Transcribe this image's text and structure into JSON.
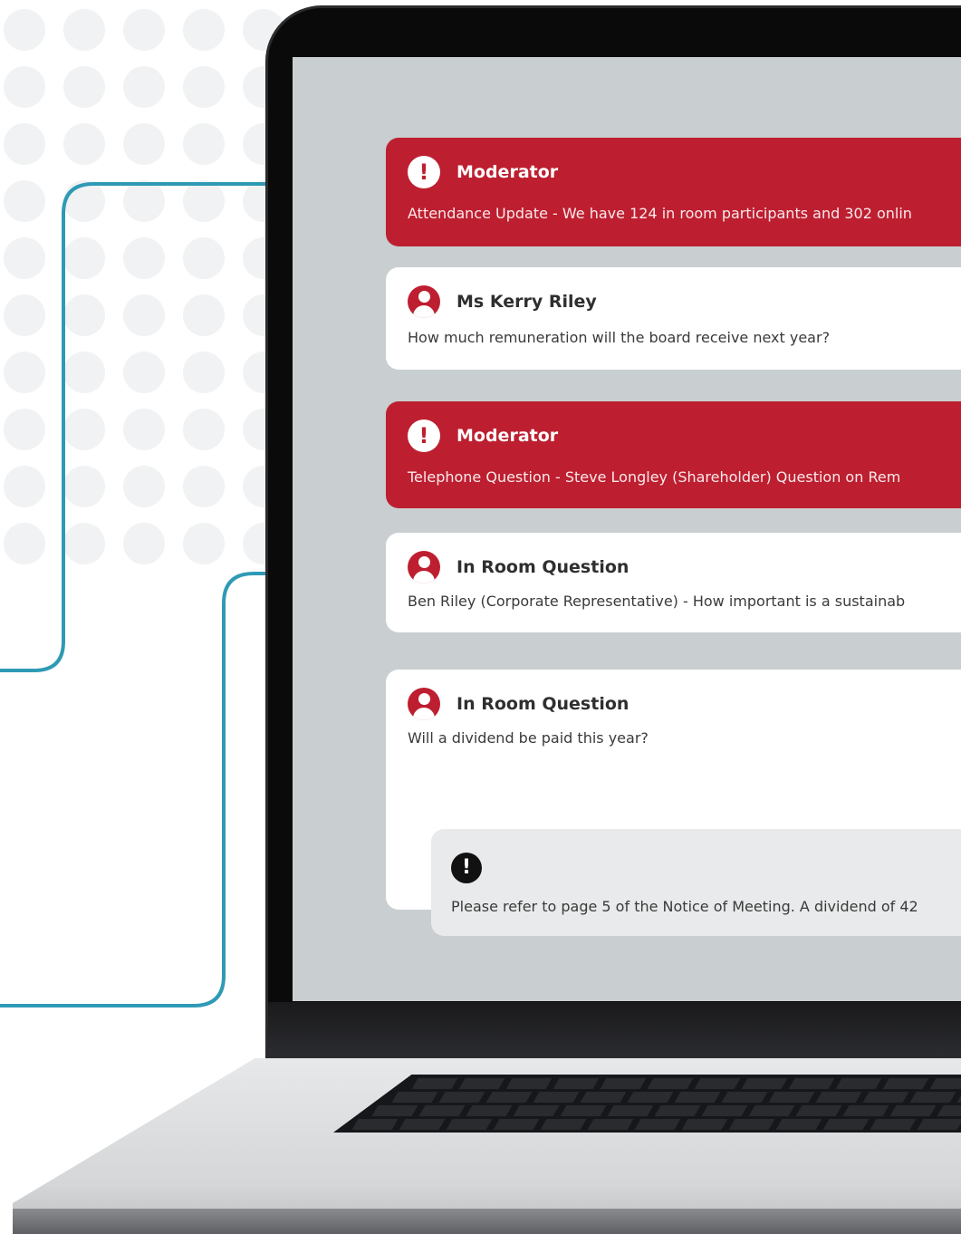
{
  "messages": [
    {
      "type": "moderator",
      "author": "Moderator",
      "icon": "alert-icon",
      "text": "Attendance Update - We have 124 in room participants and 302 onlin"
    },
    {
      "type": "question",
      "author": "Ms Kerry Riley",
      "icon": "user-icon",
      "text": "How much remuneration will the board receive next year?"
    },
    {
      "type": "moderator",
      "author": "Moderator",
      "icon": "alert-icon",
      "text": "Telephone Question - Steve Longley (Shareholder) Question on Rem"
    },
    {
      "type": "question",
      "author": "In Room Question",
      "icon": "user-icon",
      "text": "Ben Riley (Corporate Representative) - How important is a sustainab"
    },
    {
      "type": "question",
      "author": "In Room Question",
      "icon": "user-icon",
      "text": "Will a dividend be paid this year?",
      "reply": {
        "icon": "alert-icon",
        "text": "Please refer to page 5 of the Notice of Meeting. A dividend of 42"
      }
    }
  ],
  "colors": {
    "moderator_bg": "#bd1f30",
    "question_bg": "#ffffff",
    "screen_bg": "#c9cfd0",
    "connector": "#2f9ab5"
  }
}
